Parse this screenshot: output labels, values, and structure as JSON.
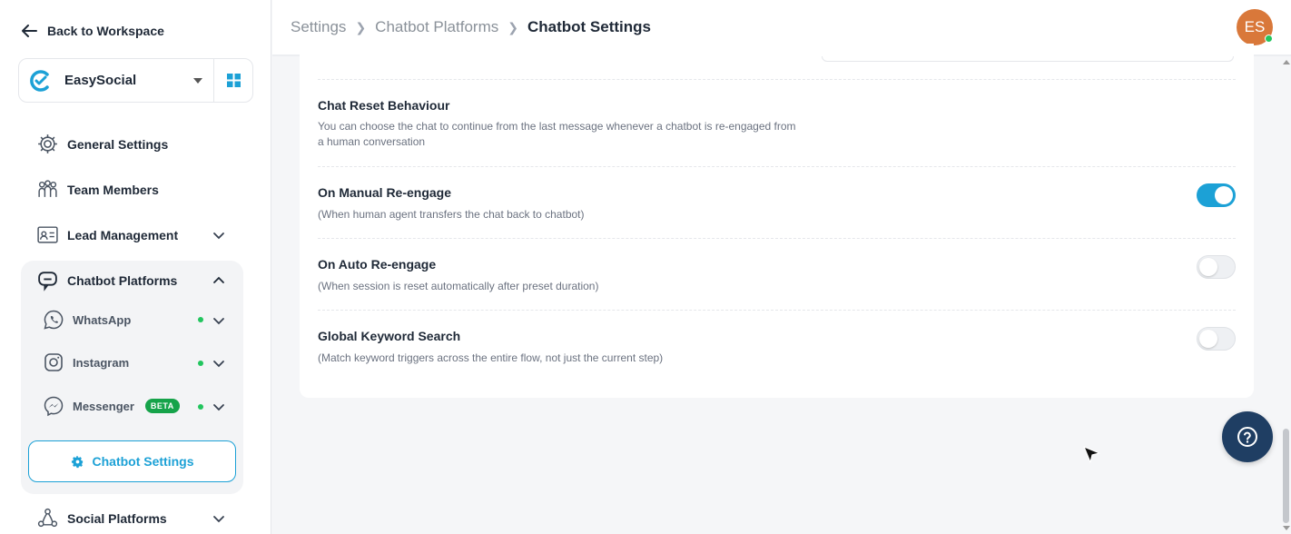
{
  "sidebar": {
    "back_label": "Back to Workspace",
    "workspace": {
      "name": "EasySocial"
    },
    "nav": {
      "general": "General Settings",
      "team": "Team Members",
      "lead": "Lead Management",
      "chatbot": "Chatbot Platforms",
      "social": "Social Platforms"
    },
    "platforms": {
      "whatsapp": "WhatsApp",
      "instagram": "Instagram",
      "messenger": "Messenger",
      "beta_badge": "BETA"
    },
    "active_item": "Chatbot Settings"
  },
  "header": {
    "breadcrumb": [
      "Settings",
      "Chatbot Platforms",
      "Chatbot Settings"
    ],
    "avatar_initials": "ES"
  },
  "settings": {
    "chat_reset": {
      "title": "Chat Reset Behaviour",
      "description": "You can choose the chat to continue from the last message whenever a chatbot is re-engaged from a human conversation"
    },
    "manual": {
      "title": "On Manual Re-engage",
      "description": "(When human agent transfers the chat back to chatbot)",
      "enabled": true
    },
    "auto": {
      "title": "On Auto Re-engage",
      "description": "(When session is reset automatically after preset duration)",
      "enabled": false
    },
    "keyword": {
      "title": "Global Keyword Search",
      "description": "(Match keyword triggers across the entire flow, not just the current step)",
      "enabled": false
    }
  },
  "colors": {
    "accent": "#1ca1d6",
    "help_button": "#1f3e63",
    "avatar": "#d9783a",
    "status_online": "#22c55e"
  }
}
